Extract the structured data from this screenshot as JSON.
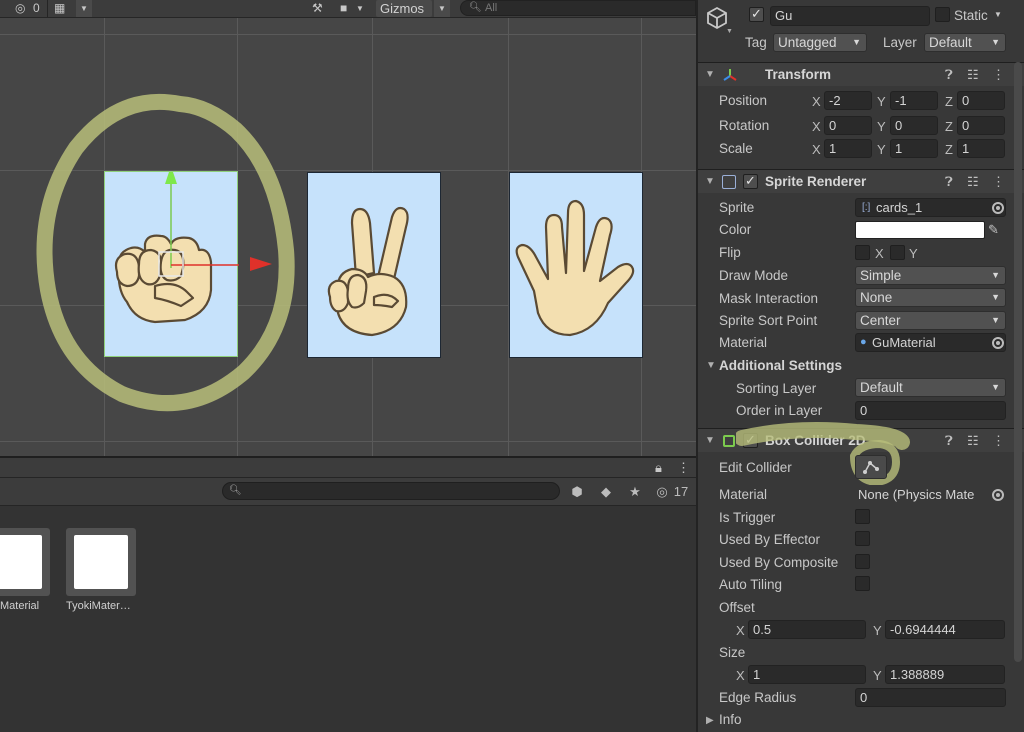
{
  "scene": {
    "toolbar": {
      "hidden_count": "0",
      "gizmos_label": "Gizmos",
      "search_placeholder": "All"
    }
  },
  "project": {
    "search_placeholder": "",
    "hidden_count": "17",
    "assets": [
      {
        "label": "Material"
      },
      {
        "label": "TyokiMater…"
      }
    ]
  },
  "inspector": {
    "object": {
      "name": "Gu",
      "static_label": "Static",
      "tag_label": "Tag",
      "tag_value": "Untagged",
      "layer_label": "Layer",
      "layer_value": "Default"
    },
    "transform": {
      "title": "Transform",
      "position_label": "Position",
      "rotation_label": "Rotation",
      "scale_label": "Scale",
      "position": {
        "x": "-2",
        "y": "-1",
        "z": "0"
      },
      "rotation": {
        "x": "0",
        "y": "0",
        "z": "0"
      },
      "scale": {
        "x": "1",
        "y": "1",
        "z": "1"
      }
    },
    "sprite_renderer": {
      "title": "Sprite Renderer",
      "sprite_label": "Sprite",
      "sprite_value": "cards_1",
      "color_label": "Color",
      "color_value": "#ffffff",
      "flip_label": "Flip",
      "flip_x": "X",
      "flip_y": "Y",
      "draw_mode_label": "Draw Mode",
      "draw_mode_value": "Simple",
      "mask_label": "Mask Interaction",
      "mask_value": "None",
      "sort_point_label": "Sprite Sort Point",
      "sort_point_value": "Center",
      "material_label": "Material",
      "material_value": "GuMaterial",
      "additional_label": "Additional Settings",
      "sorting_layer_label": "Sorting Layer",
      "sorting_layer_value": "Default",
      "order_label": "Order in Layer",
      "order_value": "0"
    },
    "box_collider": {
      "title": "Box Collider 2D",
      "edit_label": "Edit Collider",
      "material_label": "Material",
      "material_value": "None (Physics Mate",
      "trigger_label": "Is Trigger",
      "effector_label": "Used By Effector",
      "composite_label": "Used By Composite",
      "autotiling_label": "Auto Tiling",
      "offset_label": "Offset",
      "offset": {
        "x": "0.5",
        "y": "-0.6944444"
      },
      "size_label": "Size",
      "size": {
        "x": "1",
        "y": "1.388889"
      },
      "edge_radius_label": "Edge Radius",
      "edge_radius_value": "0",
      "info_label": "Info"
    }
  },
  "colors": {
    "highlight": "#b8be7a",
    "card_bg": "#c6e2fb",
    "hand_fill": "#f3dfb0"
  }
}
